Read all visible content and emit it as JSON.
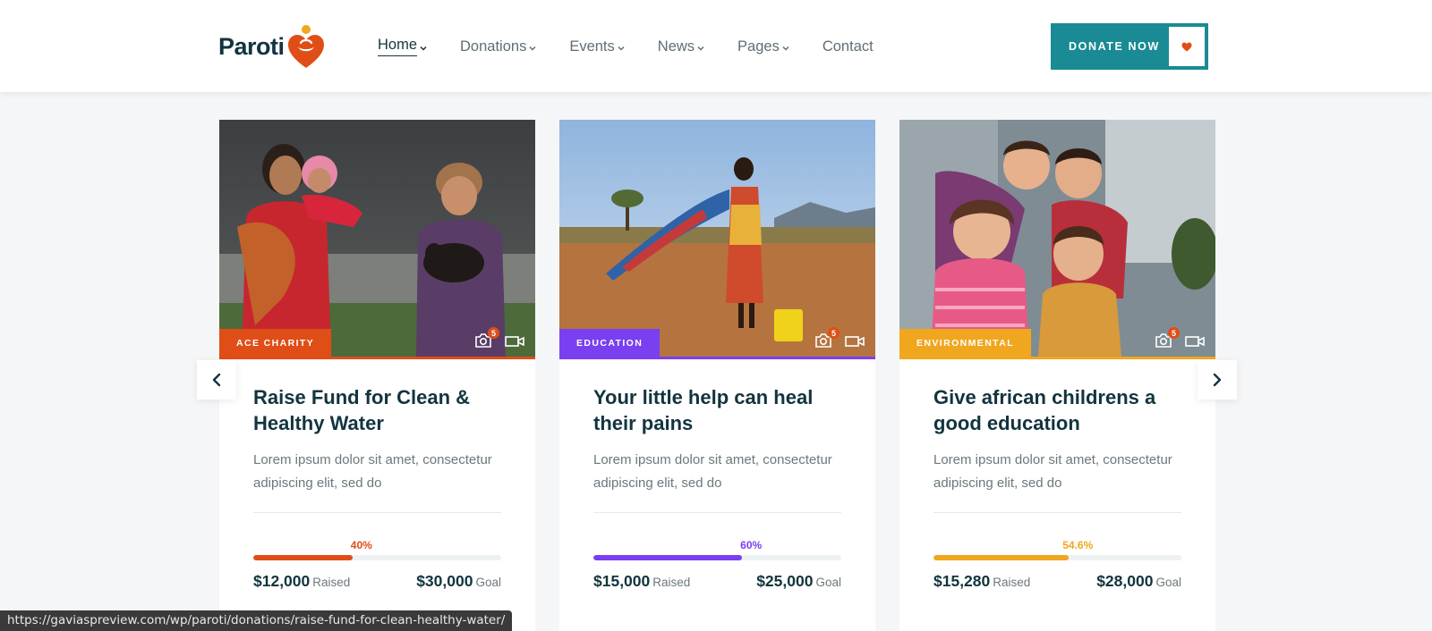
{
  "logo": {
    "text": "Paroti"
  },
  "nav": {
    "items": [
      {
        "label": "Home",
        "has_dropdown": true,
        "active": true
      },
      {
        "label": "Donations",
        "has_dropdown": true,
        "active": false
      },
      {
        "label": "Events",
        "has_dropdown": true,
        "active": false
      },
      {
        "label": "News",
        "has_dropdown": true,
        "active": false
      },
      {
        "label": "Pages",
        "has_dropdown": true,
        "active": false
      },
      {
        "label": "Contact",
        "has_dropdown": false,
        "active": false
      }
    ]
  },
  "donate_button": {
    "label": "DONATE NOW",
    "icon": "heart-icon"
  },
  "colors": {
    "brand_teal": "#1a8a94",
    "dark_text": "#12343e",
    "orange": "#e04e17",
    "purple": "#7a3ff0",
    "yellow": "#f1a61f"
  },
  "cards": [
    {
      "category": "ACE CHARITY",
      "accent": "#e04e17",
      "photo_count": "5",
      "title": "Raise Fund for Clean & Healthy Water",
      "description": "Lorem ipsum dolor sit amet, consectetur adipiscing elit, sed do",
      "progress_label": "40%",
      "progress": 0.4,
      "raised_value": "$12,000",
      "raised_label": "Raised",
      "goal_value": "$30,000",
      "goal_label": "Goal"
    },
    {
      "category": "EDUCATION",
      "accent": "#7a3ff0",
      "photo_count": "5",
      "title": "Your little help can heal their pains",
      "description": "Lorem ipsum dolor sit amet, consectetur adipiscing elit, sed do",
      "progress_label": "60%",
      "progress": 0.6,
      "raised_value": "$15,000",
      "raised_label": "Raised",
      "goal_value": "$25,000",
      "goal_label": "Goal"
    },
    {
      "category": "ENVIRONMENTAL",
      "accent": "#f1a61f",
      "photo_count": "5",
      "title": "Give african childrens a good education",
      "description": "Lorem ipsum dolor sit amet, consectetur adipiscing elit, sed do",
      "progress_label": "54.6%",
      "progress": 0.546,
      "raised_value": "$15,280",
      "raised_label": "Raised",
      "goal_value": "$28,000",
      "goal_label": "Goal"
    }
  ],
  "slider": {
    "prev_icon": "chevron-left-icon",
    "next_icon": "chevron-right-icon"
  },
  "status_bar": {
    "url": "https://gaviaspreview.com/wp/paroti/donations/raise-fund-for-clean-healthy-water/"
  }
}
